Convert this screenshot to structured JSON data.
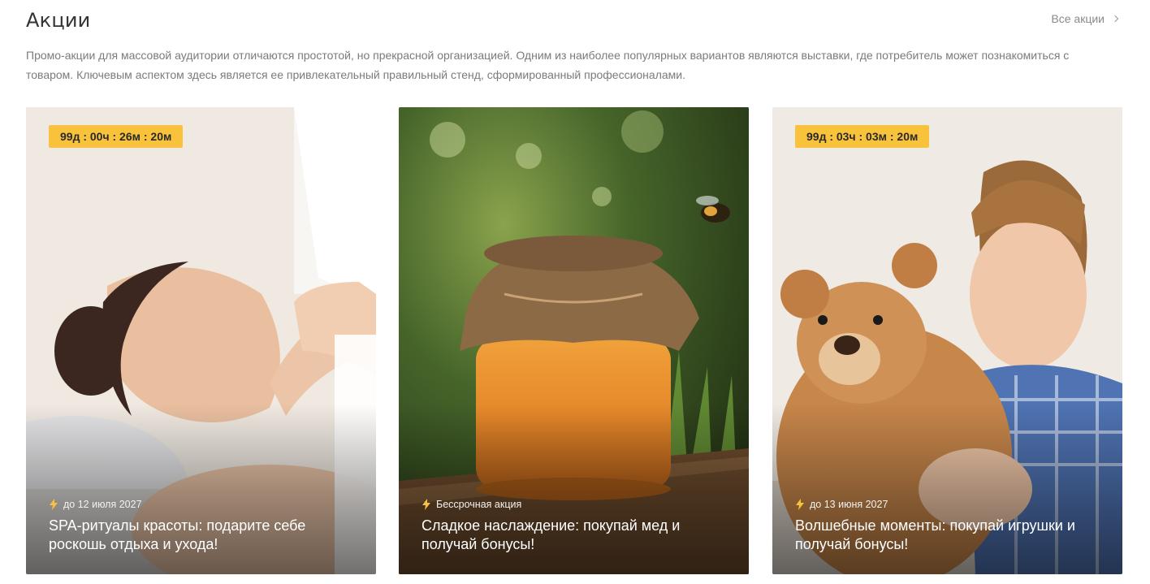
{
  "section": {
    "title": "Акции",
    "all_link": "Все акции",
    "description": "Промо-акции для массовой аудитории отличаются простотой, но прекрасной организацией. Одним из наиболее популярных вариантов являются выставки, где потребитель может познакомиться с товаром. Ключевым аспектом здесь является ее привлекательный правильный стенд, сформированный профессионалами."
  },
  "cards": [
    {
      "timer": "99д : 00ч : 26м : 20м",
      "date": "до 12 июля 2027",
      "title": "SPA-ритуалы красоты: подарите себе роскошь отдыха и ухода!",
      "image": "woman-spa-massage"
    },
    {
      "timer": "",
      "date": "Бессрочная акция",
      "title": "Сладкое наслаждение: покупай мед и получай бонусы!",
      "image": "honey-jar-with-bee"
    },
    {
      "timer": "99д : 03ч : 03м : 20м",
      "date": "до 13 июня 2027",
      "title": "Волшебные моменты: покупай игрушки и получай бонусы!",
      "image": "boy-hugging-teddy-bear"
    }
  ],
  "colors": {
    "timer_badge": "#f9c23c",
    "bolt_icon": "#f9c23c"
  }
}
